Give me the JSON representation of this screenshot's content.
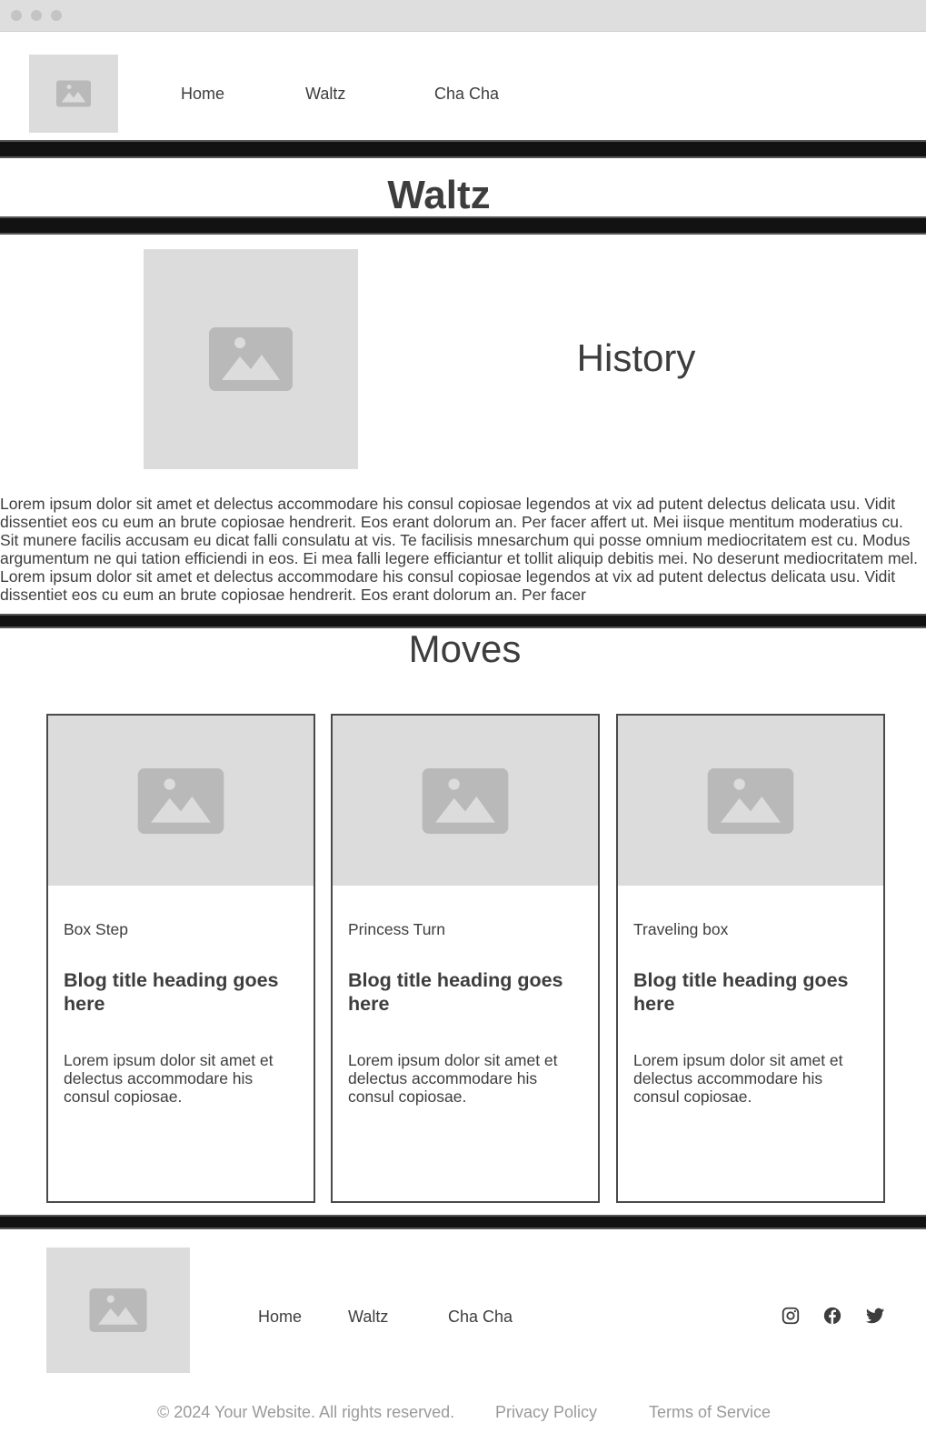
{
  "nav": {
    "links": [
      {
        "label": "Home"
      },
      {
        "label": "Waltz"
      },
      {
        "label": "Cha Cha"
      }
    ]
  },
  "page": {
    "title": "Waltz"
  },
  "history": {
    "heading": "History",
    "body": "Lorem ipsum dolor sit amet et delectus accommodare his consul copiosae legendos at vix ad putent delectus delicata usu. Vidit dissentiet eos cu eum an brute copiosae hendrerit. Eos erant dolorum an. Per facer affert ut. Mei iisque mentitum moderatius cu. Sit munere facilis accusam eu dicat falli consulatu at vis. Te facilisis mnesarchum qui posse omnium mediocritatem est cu. Modus argumentum ne qui tation efficiendi in eos. Ei mea falli legere efficiantur et tollit aliquip debitis mei. No deserunt mediocritatem mel. Lorem ipsum dolor sit amet et delectus accommodare his consul copiosae legendos at vix ad putent delectus delicata usu. Vidit dissentiet eos cu eum an brute copiosae hendrerit. Eos erant dolorum an. Per facer"
  },
  "moves": {
    "heading": "Moves",
    "cards": [
      {
        "category": "Box Step",
        "title": "Blog title heading goes here",
        "description": "Lorem ipsum dolor sit amet et delectus accommodare his consul copiosae."
      },
      {
        "category": "Princess Turn",
        "title": "Blog title heading goes here",
        "description": "Lorem ipsum dolor sit amet et delectus accommodare his consul copiosae."
      },
      {
        "category": "Traveling box",
        "title": "Blog title heading goes here",
        "description": "Lorem ipsum dolor sit amet et delectus accommodare his consul copiosae."
      }
    ]
  },
  "footer": {
    "links": [
      {
        "label": "Home"
      },
      {
        "label": "Waltz"
      },
      {
        "label": "Cha Cha"
      }
    ],
    "social_icons": [
      "instagram-icon",
      "facebook-icon",
      "twitter-icon"
    ],
    "copyright": "© 2024 Your Website. All rights reserved.",
    "privacy": "Privacy Policy",
    "terms": "Terms of Service"
  },
  "colors": {
    "text": "#3d3d3d",
    "placeholder": "#dcdcdc",
    "placeholder_icon": "#b9b9b9",
    "divider": "#121212",
    "muted": "#9a9a9a"
  }
}
